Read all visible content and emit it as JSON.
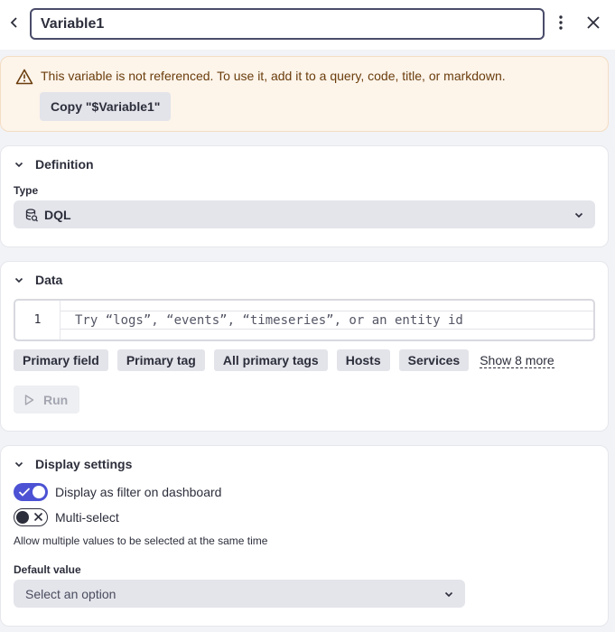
{
  "header": {
    "variable_name": "Variable1",
    "icons": {
      "back": "chevron-left-icon",
      "more": "more-vertical-icon",
      "close": "close-icon"
    }
  },
  "warning": {
    "message": "This variable is not referenced. To use it, add it to a query, code, title, or markdown.",
    "copy_label": "Copy \"$Variable1\"",
    "icon": "warning-triangle-icon",
    "color": "#6a3d0c"
  },
  "definition": {
    "title": "Definition",
    "type_label": "Type",
    "type_value": "DQL",
    "type_icon": "dql-icon"
  },
  "data": {
    "title": "Data",
    "editor": {
      "line_number": "1",
      "placeholder": "Try “logs”, “events”, “timeseries”, or an entity id"
    },
    "chips": [
      "Primary field",
      "Primary tag",
      "All primary tags",
      "Hosts",
      "Services"
    ],
    "show_more": "Show 8 more",
    "run_label": "Run"
  },
  "display": {
    "title": "Display settings",
    "filter_toggle": {
      "label": "Display as filter on dashboard",
      "checked": true
    },
    "multiselect_toggle": {
      "label": "Multi-select",
      "checked": false
    },
    "help": "Allow multiple values to be selected at the same time",
    "default_label": "Default value",
    "default_placeholder": "Select an option"
  },
  "colors": {
    "accent": "#4c52d3",
    "warning_bg": "#fdf4ea",
    "chip_bg": "#e3e4ea"
  }
}
